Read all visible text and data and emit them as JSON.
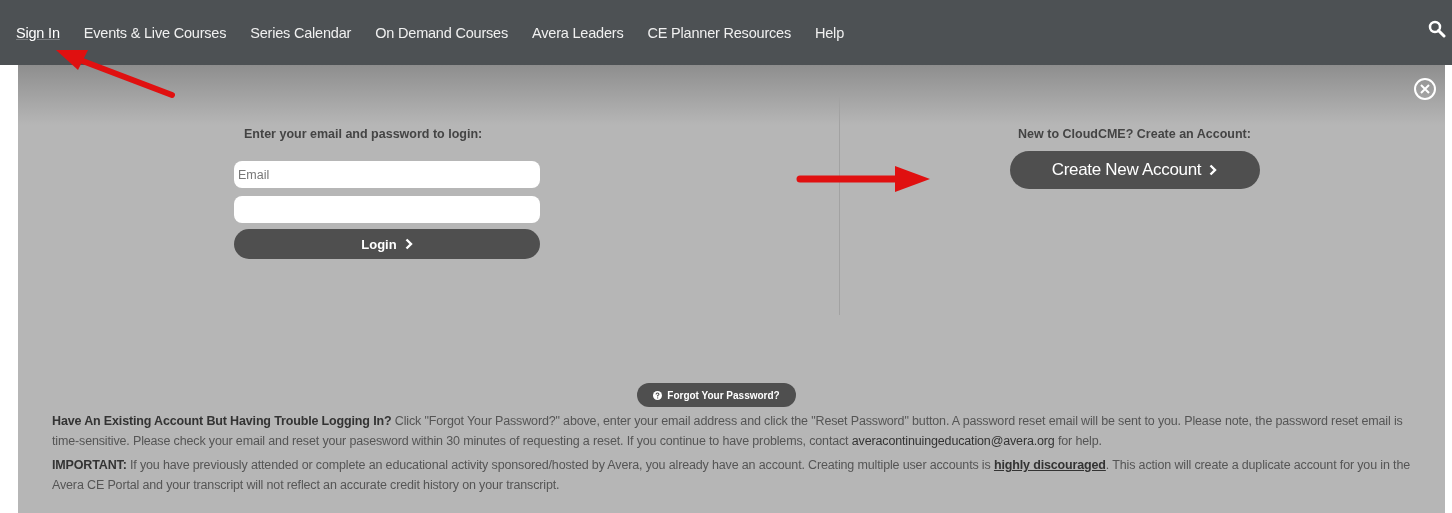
{
  "nav": {
    "items": [
      {
        "label": "Sign In",
        "selected": true
      },
      {
        "label": "Events & Live Courses",
        "selected": false
      },
      {
        "label": "Series Calendar",
        "selected": false
      },
      {
        "label": "On Demand Courses",
        "selected": false
      },
      {
        "label": "Avera Leaders",
        "selected": false
      },
      {
        "label": "CE Planner Resources",
        "selected": false
      },
      {
        "label": "Help",
        "selected": false
      }
    ]
  },
  "login": {
    "heading": "Enter your email and password to login:",
    "email_placeholder": "Email",
    "button": "Login"
  },
  "signup": {
    "heading": "New to CloudCME? Create an Account:",
    "button": "Create New Account"
  },
  "forgot_button": "Forgot Your Password?",
  "help_paragraph": {
    "text": "**Have An Existing Account But Having Trouble Logging In?**  Click \"Forgot Your Password?\" above, enter your email address and click the \"Reset Password\" button.  A password reset email will be sent to you. Please note, the password reset email is time-sensitive. Please check your email and reset your pasesword within 30 minutes of requesting a reset.  If you continue to have problems, contact",
    "link": "averacontinuingeducation@avera.org",
    "after": "for help."
  },
  "important_paragraph": {
    "text": "**IMPORTANT:**  If you have previously attended or complete an educational activity sponsored/hosted by Avera, you already have an account.  Creating multiple user accounts is",
    "emphasis": "highly discouraged",
    "after": ".  This action will create a duplicate account for you in the Avera CE Portal and your transcript will not reflect an accurate credit history on your transcript."
  }
}
